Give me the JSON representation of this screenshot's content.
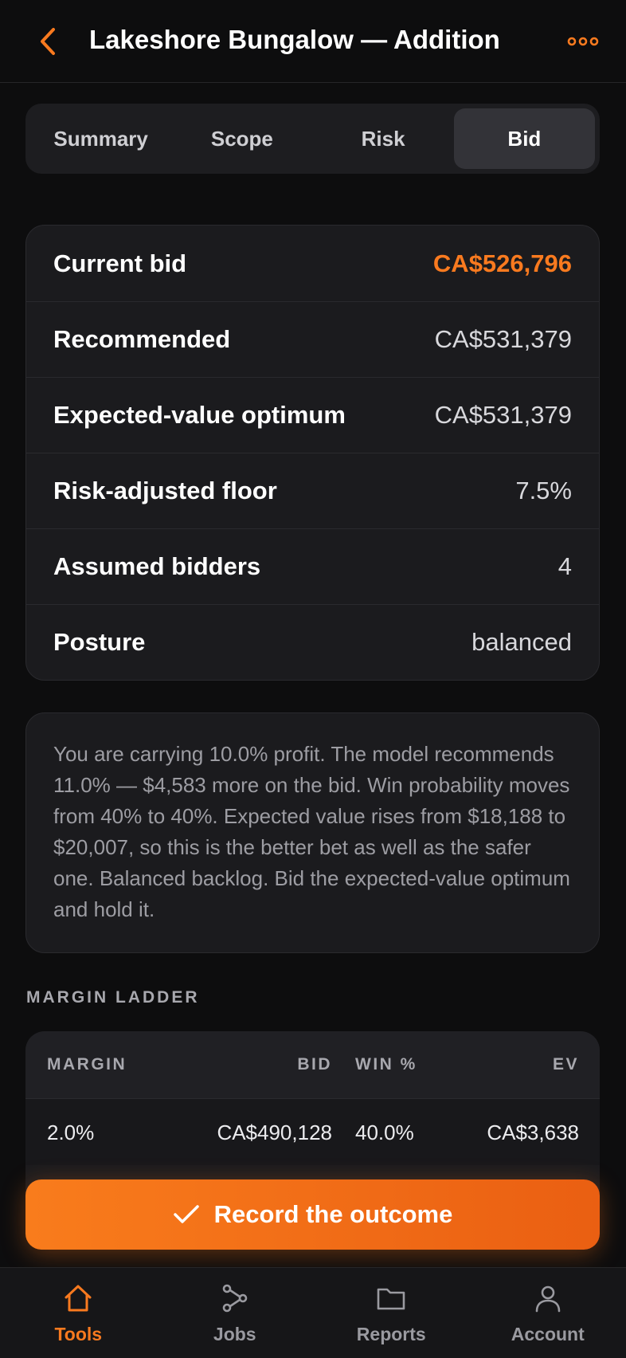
{
  "header": {
    "title": "Lakeshore Bungalow — Addition",
    "back_icon": "chevron-left-icon",
    "more_icon": "more-dots-icon"
  },
  "tabs": [
    {
      "label": "Summary",
      "active": false
    },
    {
      "label": "Scope",
      "active": false
    },
    {
      "label": "Risk",
      "active": false
    },
    {
      "label": "Bid",
      "active": true
    }
  ],
  "bid_summary": [
    {
      "label": "Current bid",
      "value": "CA$526,796"
    },
    {
      "label": "Recommended",
      "value": "CA$531,379"
    },
    {
      "label": "Expected-value optimum",
      "value": "CA$531,379"
    },
    {
      "label": "Risk-adjusted floor",
      "value": "7.5%"
    },
    {
      "label": "Assumed bidders",
      "value": "4"
    },
    {
      "label": "Posture",
      "value": "balanced"
    }
  ],
  "recommendation_note": "You are carrying 10.0% profit. The model recommends 11.0% — $4,583 more on the bid. Win probability moves from 40% to 40%. Expected value rises from $18,188 to $20,007, so this is the better bet as well as the safer one. Balanced backlog. Bid the expected-value optimum and hold it.",
  "margin_ladder": {
    "section_label": "MARGIN LADDER",
    "columns": [
      "MARGIN",
      "BID",
      "WIN %",
      "EV"
    ],
    "rows": [
      [
        "2.0%",
        "CA$490,128",
        "40.0%",
        "CA$3,638"
      ]
    ]
  },
  "cta": {
    "label": "Record the outcome",
    "icon": "checkmark-icon"
  },
  "tab_bar": [
    {
      "label": "Tools",
      "icon": "home-icon",
      "active": true
    },
    {
      "label": "Jobs",
      "icon": "jobs-graph-icon",
      "active": false
    },
    {
      "label": "Reports",
      "icon": "folder-icon",
      "active": false
    },
    {
      "label": "Account",
      "icon": "user-icon",
      "active": false
    }
  ],
  "colors": {
    "accent": "#f97a1f",
    "background": "#0d0d0e",
    "card": "#1b1b1e"
  }
}
